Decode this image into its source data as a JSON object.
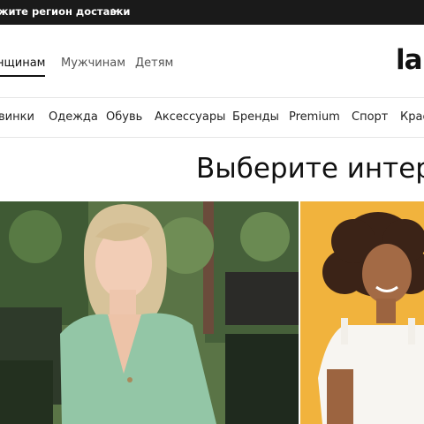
{
  "topbar": {
    "region_text": "жите регион доставки",
    "chevron_icon": "chevron-down-icon"
  },
  "gender_tabs": [
    {
      "label": "нщинам",
      "active": true
    },
    {
      "label": "Мужчинам",
      "active": false
    },
    {
      "label": "Детям",
      "active": false
    }
  ],
  "logo": {
    "text": "la"
  },
  "categories": [
    "винки",
    "Одежда",
    "Обувь",
    "Аксессуары",
    "Бренды",
    "Premium",
    "Спорт",
    "Крас"
  ],
  "main": {
    "heading": "Выберите интер"
  },
  "promos": [
    {
      "name": "women-promo",
      "background": "#4d6a3d"
    },
    {
      "name": "kids-promo",
      "background": "#f1b33d"
    }
  ],
  "colors": {
    "topbar_bg": "#1a1a1a",
    "accent_yellow": "#f1b33d"
  }
}
